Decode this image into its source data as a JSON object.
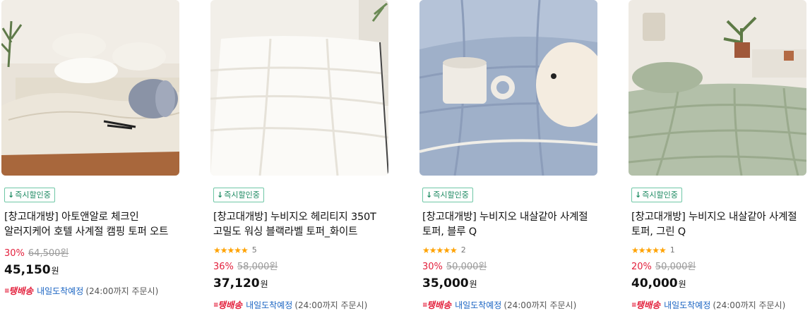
{
  "products": [
    {
      "badge": "즉시할인중",
      "title": "[창고대개방] 아토앤알로 체크인 알러지케어 호텔 사계절 캠핑 토퍼 오트",
      "rating_count": "",
      "discount": "30%",
      "original_price": "64,500원",
      "sale_price": "45,150",
      "currency": "원",
      "delivery_brand": "탱배송",
      "delivery_arrival": "내일도착예정",
      "delivery_cutoff": "(24:00까지 주문시)",
      "image_subject": "beige-bedding-room"
    },
    {
      "badge": "즉시할인중",
      "title": "[창고대개방] 누비지오 헤리티지 350T 고밀도 워싱 블랙라벨 토퍼_화이트",
      "stars": "★★★★★",
      "rating_count": "5",
      "discount": "36%",
      "original_price": "58,000원",
      "sale_price": "37,120",
      "currency": "원",
      "delivery_brand": "탱배송",
      "delivery_arrival": "내일도착예정",
      "delivery_cutoff": "(24:00까지 주문시)",
      "image_subject": "white-topper"
    },
    {
      "badge": "즉시할인중",
      "title": "[창고대개방] 누비지오 내살같아 사계절 토퍼, 블루 Q",
      "stars": "★★★★★",
      "rating_count": "2",
      "discount": "30%",
      "original_price": "50,000원",
      "sale_price": "35,000",
      "currency": "원",
      "delivery_brand": "탱배송",
      "delivery_arrival": "내일도착예정",
      "delivery_cutoff": "(24:00까지 주문시)",
      "image_subject": "blue-topper-with-mug"
    },
    {
      "badge": "즉시할인중",
      "title": "[창고대개방] 누비지오 내살같아 사계절 토퍼, 그린 Q",
      "stars": "★★★★★",
      "rating_count": "1",
      "discount": "20%",
      "original_price": "50,000원",
      "sale_price": "40,000",
      "currency": "원",
      "delivery_brand": "탱배송",
      "delivery_arrival": "내일도착예정",
      "delivery_cutoff": "(24:00까지 주문시)",
      "image_subject": "green-topper-room"
    }
  ],
  "colors": {
    "discount": "#e3213d",
    "badge_border": "#6fc7a6",
    "badge_text": "#1f8b63",
    "star": "#ffa200",
    "arrival": "#1d66c3"
  }
}
